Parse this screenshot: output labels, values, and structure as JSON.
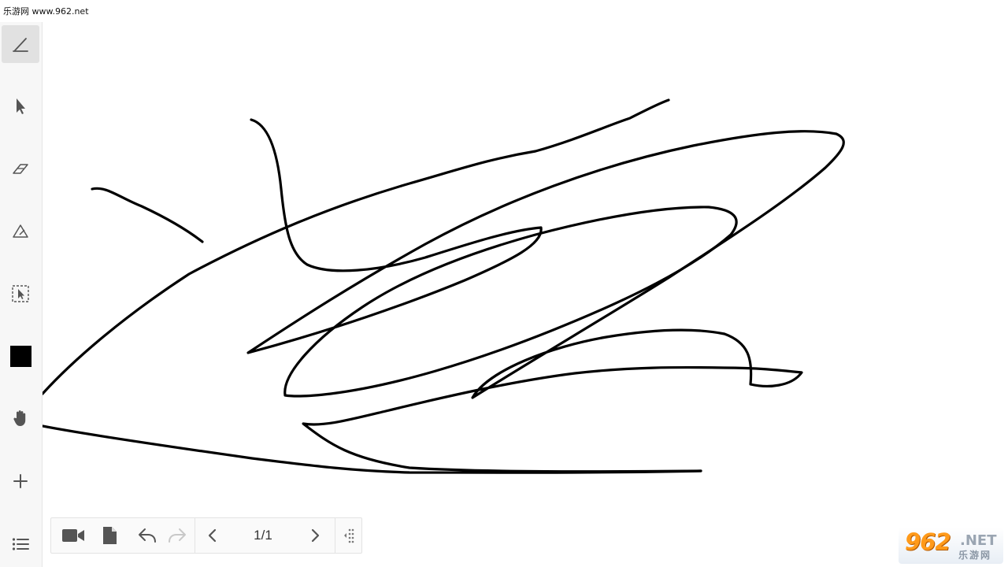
{
  "header": {
    "watermark": "乐游网 www.962.net"
  },
  "sidebar": {
    "tools": [
      {
        "name": "pen",
        "icon": "pen-icon",
        "active": true
      },
      {
        "name": "select",
        "icon": "cursor-icon"
      },
      {
        "name": "eraser",
        "icon": "eraser-icon"
      },
      {
        "name": "shape",
        "icon": "shape-icon"
      },
      {
        "name": "area-select",
        "icon": "area-select-icon"
      },
      {
        "name": "color",
        "icon": "color-swatch",
        "color": "#000000"
      },
      {
        "name": "hand",
        "icon": "hand-icon"
      },
      {
        "name": "add",
        "icon": "plus-icon"
      },
      {
        "name": "menu",
        "icon": "list-icon"
      }
    ]
  },
  "toolbar": {
    "page_indicator": "1/1",
    "buttons": [
      "video-icon",
      "document-icon",
      "undo-icon",
      "redo-icon",
      "prev-page-icon",
      "next-page-icon",
      "drag-handle-icon"
    ]
  },
  "logo": {
    "number": "962",
    "suffix": ".NET",
    "chinese": "乐游网"
  },
  "colors": {
    "ink": "#000000",
    "sidebar_bg": "#f7f7f7",
    "active_tool": "#e1e1e1",
    "icon": "#555555",
    "logo_orange": "#ff9a1a"
  }
}
